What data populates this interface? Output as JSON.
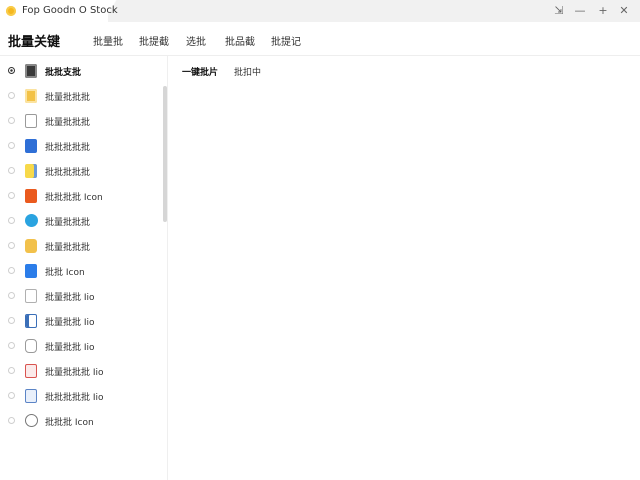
{
  "window": {
    "title": "Fop Goodn O Stock",
    "buttons": {
      "pin": "⇲",
      "minimize": "—",
      "maximize": "+",
      "close": "✕"
    }
  },
  "header": {
    "title": "批量关键",
    "nav": [
      "批量批",
      "批提截",
      "选批",
      "批品截",
      "批提记"
    ]
  },
  "sidebar": {
    "items": [
      {
        "label": "批批支批",
        "icon": "image-file-icon",
        "active": true
      },
      {
        "label": "批量批批批",
        "icon": "folder-file-icon",
        "active": false
      },
      {
        "label": "批量批批批",
        "icon": "document-file-icon",
        "active": false
      },
      {
        "label": "批批批批批",
        "icon": "word-file-icon",
        "active": false
      },
      {
        "label": "批批批批批",
        "icon": "note-file-icon",
        "active": false
      },
      {
        "label": "批批批批 Icon",
        "icon": "pdf-file-icon",
        "active": false
      },
      {
        "label": "批量批批批",
        "icon": "globe-file-icon",
        "active": false
      },
      {
        "label": "批量批批批",
        "icon": "archive-file-icon",
        "active": false
      },
      {
        "label": "批批 Icon",
        "icon": "presentation-file-icon",
        "active": false
      },
      {
        "label": "批量批批 Iio",
        "icon": "text-file-icon",
        "active": false
      },
      {
        "label": "批量批批 Iio",
        "icon": "book-file-icon",
        "active": false
      },
      {
        "label": "批量批批 Iio",
        "icon": "link-file-icon",
        "active": false
      },
      {
        "label": "批量批批批 Iio",
        "icon": "red-doc-file-icon",
        "active": false
      },
      {
        "label": "批批批批批 Iio",
        "icon": "table-file-icon",
        "active": false
      },
      {
        "label": "批批批 Icon",
        "icon": "chat-file-icon",
        "active": false
      }
    ]
  },
  "main": {
    "tabs": [
      "一键批片",
      "批扣中"
    ]
  },
  "colors": {
    "accent": "#f5b820",
    "active_radio": "#333333"
  }
}
